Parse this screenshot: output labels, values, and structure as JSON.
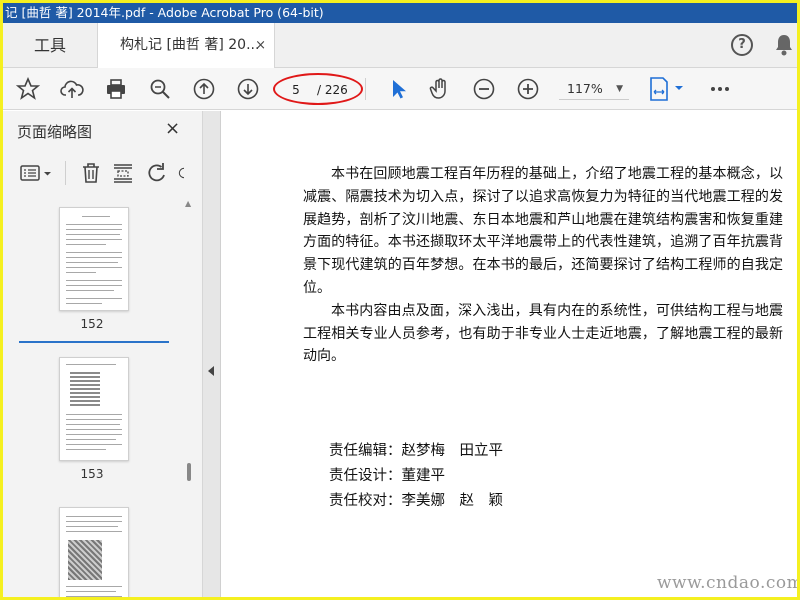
{
  "window": {
    "title": "记 [曲哲 著] 2014年.pdf - Adobe Acrobat Pro (64-bit)"
  },
  "tabs": {
    "tools": "工具",
    "document": "构札记 [曲哲 著] 20...",
    "close": "×"
  },
  "toolbar": {
    "page_current": "5",
    "page_total": "/ 226",
    "zoom": "117%",
    "icons": [
      "star-icon",
      "upload-icon",
      "print-icon",
      "zoom-search-icon",
      "page-up-icon",
      "page-down-icon",
      "select-arrow-icon",
      "hand-icon",
      "zoom-out-icon",
      "zoom-in-icon",
      "fit-page-icon",
      "more-icon"
    ]
  },
  "panel": {
    "title": "页面缩略图",
    "close": "×",
    "thumbnails": [
      {
        "label": "152"
      },
      {
        "label": "153"
      },
      {
        "label": ""
      }
    ]
  },
  "document": {
    "paragraphs": [
      "本书在回顾地震工程百年历程的基础上，介绍了地震工程的基本概念，以减震、隔震技术为切入点，探讨了以追求高恢复力为特征的当代地震工程的发展趋势，剖析了汶川地震、东日本地震和芦山地震在建筑结构震害和恢复重建方面的特征。本书还撷取环太平洋地震带上的代表性建筑，追溯了百年抗震背景下现代建筑的百年梦想。在本书的最后，还简要探讨了结构工程师的自我定位。",
      "本书内容由点及面，深入浅出，具有内在的系统性，可供结构工程与地震工程相关专业人员参考，也有助于非专业人士走近地震，了解地震工程的最新动向。"
    ],
    "credits": [
      "责任编辑：赵梦梅　田立平",
      "责任设计：董建平",
      "责任校对：李美娜　赵　颖"
    ]
  },
  "watermark": "www.cndao.com",
  "colors": {
    "titlebar": "#1f5aa6",
    "accent": "#2a73c9",
    "highlight_ring": "#e01818",
    "frame": "#f5f020"
  }
}
